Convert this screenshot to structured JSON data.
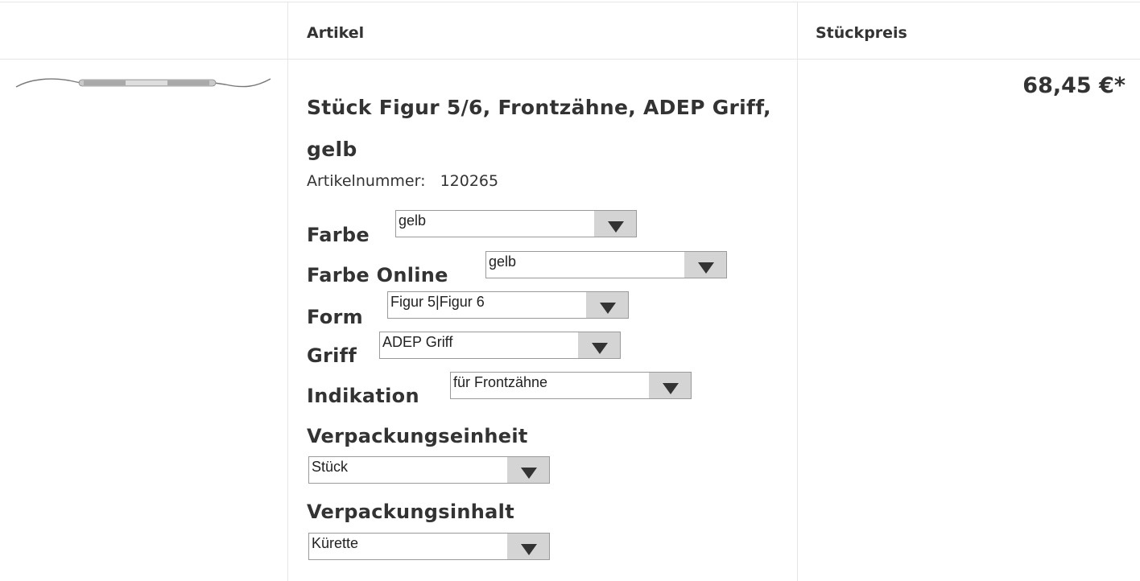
{
  "header": {
    "col_article": "Artikel",
    "col_unit_price": "Stückpreis"
  },
  "product": {
    "title": "Stück Figur 5/6, Frontzähne, ADEP Griff, gelb",
    "sku_label": "Artikelnummer:",
    "sku_value": "120265",
    "price": "68,45 €*",
    "options": [
      {
        "label": "Farbe",
        "value": "gelb"
      },
      {
        "label": "Farbe Online",
        "value": "gelb"
      },
      {
        "label": "Form",
        "value": "Figur 5|Figur 6"
      },
      {
        "label": "Griff",
        "value": "ADEP Griff"
      },
      {
        "label": "Indikation",
        "value": "für Frontzähne"
      },
      {
        "label": "Verpackungseinheit",
        "value": "Stück"
      },
      {
        "label": "Verpackungsinhalt",
        "value": "Kürette"
      }
    ]
  }
}
